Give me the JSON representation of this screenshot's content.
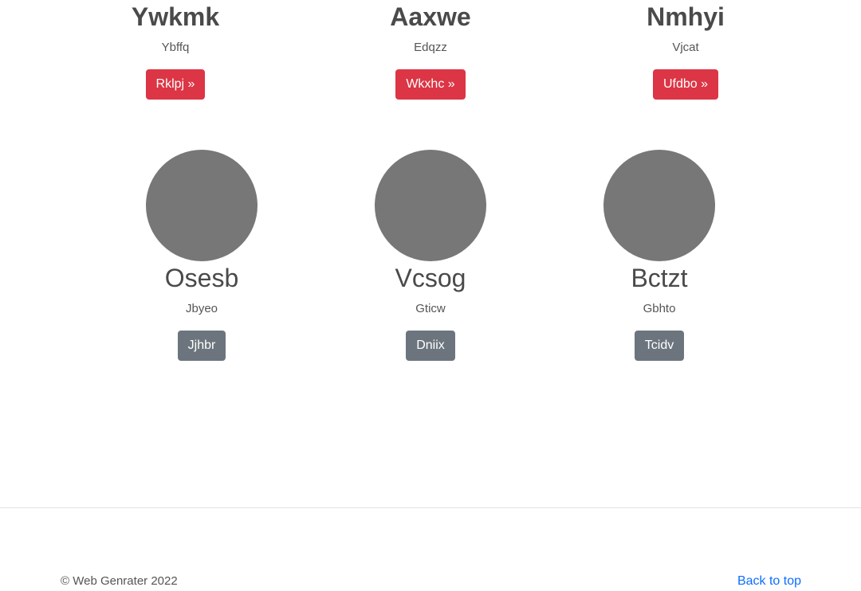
{
  "features": [
    {
      "title": "Ywkmk",
      "subtitle": "Ybffq",
      "button": "Rklpj »"
    },
    {
      "title": "Aaxwe",
      "subtitle": "Edqzz",
      "button": "Wkxhc »"
    },
    {
      "title": "Nmhyi",
      "subtitle": "Vjcat",
      "button": "Ufdbo »"
    }
  ],
  "members": [
    {
      "name": "Osesb",
      "subtitle": "Jbyeo",
      "button": "Jjhbr"
    },
    {
      "name": "Vcsog",
      "subtitle": "Gticw",
      "button": "Dniix"
    },
    {
      "name": "Bctzt",
      "subtitle": "Gbhto",
      "button": "Tcidv"
    }
  ],
  "footer": {
    "copyright": "© Web Genrater 2022",
    "back_to_top": "Back to top"
  },
  "colors": {
    "danger": "#dc3545",
    "secondary": "#6c757d",
    "avatar_placeholder": "#777777",
    "link": "#0d6efd"
  }
}
